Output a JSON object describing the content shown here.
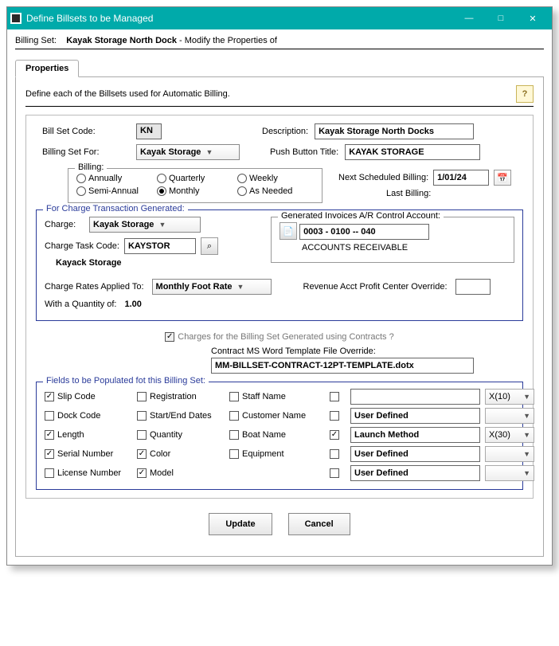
{
  "window": {
    "title": "Define Billsets to be Managed",
    "min": "—",
    "max": "□",
    "close": "✕"
  },
  "top": {
    "billing_set_lbl": "Billing Set:",
    "billing_set_name": "Kayak Storage North Dock",
    "suffix": "- Modify the Properties of"
  },
  "tab": {
    "label": "Properties"
  },
  "intro": "Define each of the Billsets used for Automatic Billing.",
  "help_glyph": "?",
  "codes": {
    "bill_set_code_lbl": "Bill Set Code:",
    "bill_set_code": "KN",
    "description_lbl": "Description:",
    "description": "Kayak Storage North Docks",
    "billing_set_for_lbl": "Billing Set For:",
    "billing_set_for": "Kayak Storage",
    "push_button_title_lbl": "Push Button Title:",
    "push_button_title": "KAYAK STORAGE"
  },
  "billing": {
    "legend": "Billing:",
    "options": [
      {
        "label": "Annually",
        "selected": false
      },
      {
        "label": "Quarterly",
        "selected": false
      },
      {
        "label": "Weekly",
        "selected": false
      },
      {
        "label": "Semi-Annual",
        "selected": false
      },
      {
        "label": "Monthly",
        "selected": true
      },
      {
        "label": "As Needed",
        "selected": false
      }
    ],
    "next_lbl": "Next Scheduled Billing:",
    "next_date": "1/01/24",
    "last_lbl": "Last Billing:"
  },
  "charge": {
    "legend": "For Charge Transaction Generated:",
    "charge_lbl": "Charge:",
    "charge": "Kayak Storage",
    "task_code_lbl": "Charge Task Code:",
    "task_code": "KAYSTOR",
    "task_name": "Kayack Storage",
    "rates_lbl": "Charge Rates Applied To:",
    "rates": "Monthly Foot Rate",
    "qty_lbl": "With a Quantity of:",
    "qty": "1.00",
    "gen_acct_legend": "Generated Invoices A/R Control Account:",
    "acct_code": "0003 - 0100 -- 040",
    "acct_name": "ACCOUNTS RECEIVABLE",
    "rev_override_lbl": "Revenue Acct Profit Center Override:",
    "rev_override": "",
    "lookup_glyph": "⌕",
    "doc_glyph": "📄"
  },
  "contracts": {
    "check_label": "Charges for the Billing Set Generated using Contracts ?",
    "template_lbl": "Contract MS Word Template File Override:",
    "template": "MM-BILLSET-CONTRACT-12PT-TEMPLATE.dotx"
  },
  "fields": {
    "legend": "Fields to be Populated fot this Billing Set:",
    "col1": [
      {
        "label": "Slip Code",
        "checked": true
      },
      {
        "label": "Dock Code",
        "checked": false
      },
      {
        "label": "Length",
        "checked": true
      },
      {
        "label": "Serial Number",
        "checked": true
      },
      {
        "label": "License Number",
        "checked": false
      }
    ],
    "col2": [
      {
        "label": "Registration",
        "checked": false
      },
      {
        "label": "Start/End Dates",
        "checked": false
      },
      {
        "label": "Quantity",
        "checked": false
      },
      {
        "label": "Color",
        "checked": true
      },
      {
        "label": "Model",
        "checked": true
      }
    ],
    "col3": [
      {
        "label": "Staff Name",
        "checked": false
      },
      {
        "label": "Customer Name",
        "checked": false
      },
      {
        "label": "Boat Name",
        "checked": false
      },
      {
        "label": "Equipment",
        "checked": false
      }
    ],
    "userdef": [
      {
        "checked": false,
        "text": "",
        "width": "X(10)"
      },
      {
        "checked": false,
        "text": "User Defined",
        "width": ""
      },
      {
        "checked": true,
        "text": "Launch Method",
        "width": "X(30)"
      },
      {
        "checked": false,
        "text": "User Defined",
        "width": ""
      },
      {
        "checked": false,
        "text": "User Defined",
        "width": ""
      }
    ]
  },
  "buttons": {
    "update": "Update",
    "cancel": "Cancel"
  }
}
